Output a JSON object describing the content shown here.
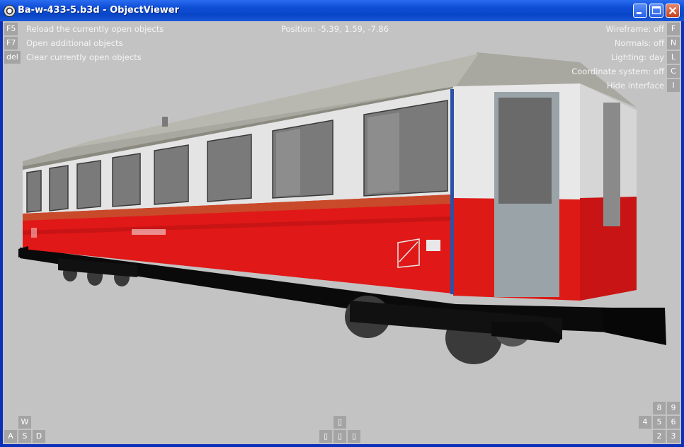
{
  "window": {
    "title": "Ba-w-433-5.b3d - ObjectViewer",
    "icon": "objectviewer-app-icon",
    "controls": [
      "minimize-icon",
      "maximize-icon",
      "close-icon"
    ]
  },
  "shortcuts_left": [
    {
      "key": "F5",
      "label": "Reload the currently open objects"
    },
    {
      "key": "F7",
      "label": "Open additional objects"
    },
    {
      "key": "del",
      "label": "Clear currently open objects"
    }
  ],
  "position": "Position: -5.39, 1.59, -7.86",
  "toggles_right": [
    {
      "label": "Wireframe: off",
      "key": "F"
    },
    {
      "label": "Normals: off",
      "key": "N"
    },
    {
      "label": "Lighting: day",
      "key": "L"
    },
    {
      "label": "Coordinate system: off",
      "key": "C"
    },
    {
      "label": "Hide interface",
      "key": "I"
    }
  ],
  "move_keys": {
    "up": "W",
    "left": "A",
    "down": "S",
    "right": "D"
  },
  "arrow_keys": {
    "up": "▯",
    "left": "▯",
    "down": "▯",
    "right": "▯"
  },
  "numpad_keys": {
    "k8": "8",
    "k9": "9",
    "k4": "4",
    "k5": "5",
    "k6": "6",
    "k2": "2",
    "k3": "3"
  },
  "colors": {
    "viewport_bg": "#c3c3c3",
    "key_bg": "#a4a4a4",
    "titlebar": "#0846c8",
    "coach_red": "#e01818",
    "coach_white": "#e6e6e6",
    "roof": "#a8a8a0"
  }
}
